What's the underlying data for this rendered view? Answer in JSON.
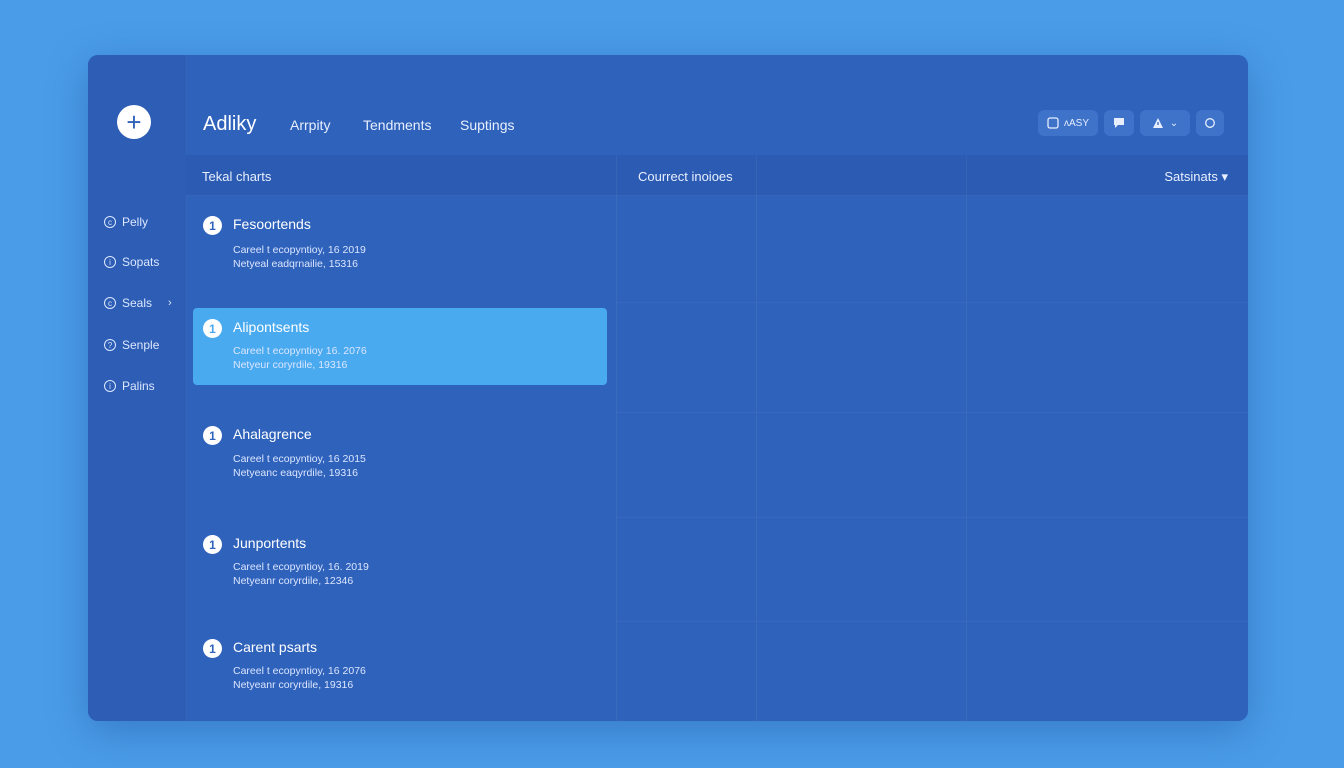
{
  "colors": {
    "background": "#4a9ce8",
    "window": "#2f62bb",
    "selected": "#4aaaf0",
    "dot_red": "#e05a6a",
    "dot_yellow": "#d9c84a",
    "dot_blue": "#59a8ea"
  },
  "app": {
    "title": "Adliky"
  },
  "nav": {
    "links": [
      "Arrpity",
      "Tendments",
      "Suptings"
    ]
  },
  "toolbar": {
    "first_label": "ʌASY"
  },
  "rail": {
    "add_icon": "plus-icon",
    "items": [
      {
        "label": "Pelly",
        "icon": "circle-icon"
      },
      {
        "label": "Sopats",
        "icon": "info-icon"
      },
      {
        "label": "Seals",
        "icon": "circle-icon",
        "chevron": "›"
      },
      {
        "label": "Senple",
        "icon": "question-icon"
      },
      {
        "label": "Palins",
        "icon": "info-icon"
      }
    ]
  },
  "table": {
    "col1_header": "Tekal charts",
    "col2_header": "Courrect inoioes",
    "col3_header": "Satsinats ▾"
  },
  "list": [
    {
      "title": "Fesoortends",
      "line1": "Careel t ecopyntioy, 16 2019",
      "line2": "Netyeal eadqrnailie, 15316",
      "selected": false
    },
    {
      "title": "Alipontsents",
      "line1": "Careel t ecopyntioy 16. 2076",
      "line2": "Netyeur coryrdile, 19316",
      "selected": true
    },
    {
      "title": "Ahalagrence",
      "line1": "Careel t ecopyntioy, 16 2015",
      "line2": "Netyeanc eaqyrdile, 19316",
      "selected": false
    },
    {
      "title": "Junportents",
      "line1": "Careel t ecopyntioy, 16. 2019",
      "line2": "Netyeanr coryrdile, 12346",
      "selected": false
    },
    {
      "title": "Carent psarts",
      "line1": "Careel t ecopyntioy, 16 2076",
      "line2": "Netyeanr coryrdile, 19316",
      "selected": false
    }
  ]
}
